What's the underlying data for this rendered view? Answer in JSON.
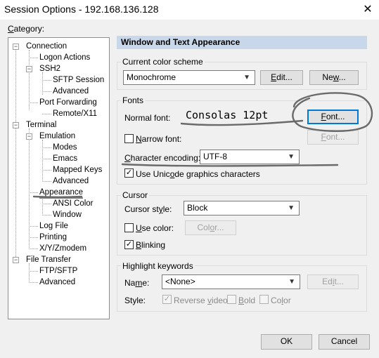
{
  "window": {
    "title": "Session Options - 192.168.136.128",
    "close_glyph": "✕"
  },
  "category": {
    "label": "Category:",
    "tree": [
      {
        "label": "Connection"
      },
      {
        "label": "Logon Actions"
      },
      {
        "label": "SSH2"
      },
      {
        "label": "SFTP Session"
      },
      {
        "label": "Advanced"
      },
      {
        "label": "Port Forwarding"
      },
      {
        "label": "Remote/X11"
      },
      {
        "label": "Terminal"
      },
      {
        "label": "Emulation"
      },
      {
        "label": "Modes"
      },
      {
        "label": "Emacs"
      },
      {
        "label": "Mapped Keys"
      },
      {
        "label": "Advanced"
      },
      {
        "label": "Appearance",
        "selected": true
      },
      {
        "label": "ANSI Color"
      },
      {
        "label": "Window"
      },
      {
        "label": "Log File"
      },
      {
        "label": "Printing"
      },
      {
        "label": "X/Y/Zmodem"
      },
      {
        "label": "File Transfer"
      },
      {
        "label": "FTP/SFTP"
      },
      {
        "label": "Advanced"
      }
    ]
  },
  "panel": {
    "header": "Window and Text Appearance",
    "color_scheme": {
      "group_label": "Current color scheme",
      "value": "Monochrome",
      "edit_button": "Edit...",
      "new_button": "New..."
    },
    "fonts": {
      "group_label": "Fonts",
      "normal_font_label": "Normal font:",
      "normal_font_value": "Consolas 12pt",
      "font_button": "Font...",
      "narrow_font_label": "Narrow font:",
      "narrow_font_button": "Font...",
      "encoding_label": "Character encoding:",
      "encoding_value": "UTF-8",
      "unicode_graphics_label": "Use Unicode graphics characters",
      "unicode_graphics_checked": true,
      "narrow_font_checked": false
    },
    "cursor": {
      "group_label": "Cursor",
      "style_label": "Cursor style:",
      "style_value": "Block",
      "use_color_label": "Use color:",
      "use_color_checked": false,
      "color_button": "Color...",
      "blinking_label": "Blinking",
      "blinking_checked": true
    },
    "highlight": {
      "group_label": "Highlight keywords",
      "name_label": "Name:",
      "name_value": "<None>",
      "edit_button": "Edit...",
      "style_label": "Style:",
      "reverse_video_label": "Reverse video",
      "reverse_video_checked": true,
      "bold_label": "Bold",
      "bold_checked": false,
      "color_label": "Color",
      "color_checked": false
    }
  },
  "footer": {
    "ok": "OK",
    "cancel": "Cancel"
  },
  "colors": {
    "header_bg": "#c8d8ea",
    "selected_item_underline": "#808080",
    "annotation_ink": "#606060"
  },
  "icons": {
    "expanded": "minus-expander-icon",
    "combo_arrow": "chevron-down-icon",
    "check": "checkmark-icon"
  }
}
